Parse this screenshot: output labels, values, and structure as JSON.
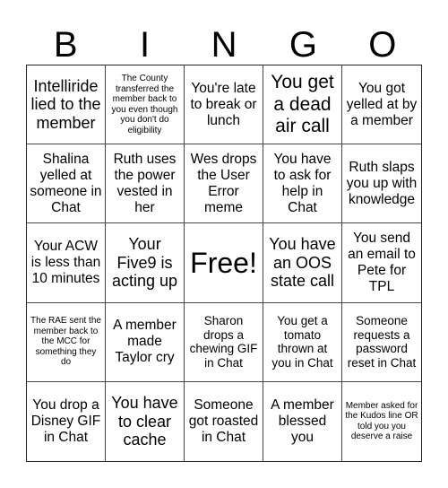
{
  "header": {
    "letters": [
      "B",
      "I",
      "N",
      "G",
      "O"
    ]
  },
  "cells": [
    {
      "text": "Intelliride lied to the member",
      "size": "s18"
    },
    {
      "text": "The County transferred the member back to you even though you don't do eligibility",
      "size": "s10"
    },
    {
      "text": "You're late to break or lunch",
      "size": "s15"
    },
    {
      "text": "You get a dead air call",
      "size": "s21"
    },
    {
      "text": "You got yelled at by a member",
      "size": "s15"
    },
    {
      "text": "Shalina yelled at someone in Chat",
      "size": "s15"
    },
    {
      "text": "Ruth uses the power vested in her",
      "size": "s15"
    },
    {
      "text": "Wes drops the User Error meme",
      "size": "s15"
    },
    {
      "text": "You have to ask for help in Chat",
      "size": "s15"
    },
    {
      "text": "Ruth slaps you up with knowledge",
      "size": "s15"
    },
    {
      "text": "Your ACW is less than 10 minutes",
      "size": "s15"
    },
    {
      "text": "Your Five9 is acting up",
      "size": "s18"
    },
    {
      "text": "Free!",
      "size": "s32"
    },
    {
      "text": "You have an OOS state call",
      "size": "s18"
    },
    {
      "text": "You send an email to Pete for TPL",
      "size": "s15"
    },
    {
      "text": "The RAE sent the member back to the MCC for something they do",
      "size": "s10"
    },
    {
      "text": "A member made Taylor cry",
      "size": "s15"
    },
    {
      "text": "Sharon drops a chewing GIF in Chat",
      "size": "s13"
    },
    {
      "text": "You get a tomato thrown at you in Chat",
      "size": "s13"
    },
    {
      "text": "Someone requests a password reset in Chat",
      "size": "s13"
    },
    {
      "text": "You drop a Disney GIF in Chat",
      "size": "s15"
    },
    {
      "text": "You have to clear cache",
      "size": "s18"
    },
    {
      "text": "Someone got roasted in Chat",
      "size": "s15"
    },
    {
      "text": "A member blessed you",
      "size": "s15"
    },
    {
      "text": "Member asked for the Kudos line OR told you you deserve a raise",
      "size": "s10"
    }
  ]
}
